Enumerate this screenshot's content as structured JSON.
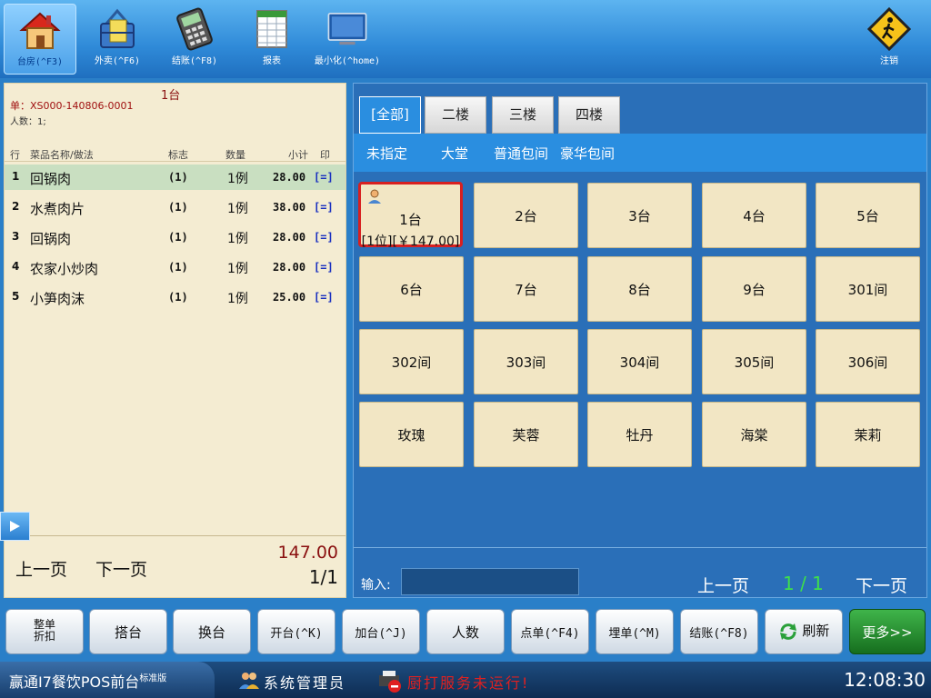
{
  "toolbar": {
    "items": [
      {
        "label": "台房(^F3)",
        "icon": "house-icon"
      },
      {
        "label": "外卖(^F6)",
        "icon": "delivery-basket-icon"
      },
      {
        "label": "结账(^F8)",
        "icon": "pos-terminal-icon"
      },
      {
        "label": "报表",
        "icon": "spreadsheet-icon"
      },
      {
        "label": "最小化(^home)",
        "icon": "monitor-icon"
      }
    ],
    "logout_label": "注销",
    "logout_icon": "pedestrian-sign-icon"
  },
  "order": {
    "table": "1台",
    "number": "单：XS000-140806-0001",
    "people": "人数：1;",
    "headers": {
      "row": "行",
      "name": "菜品名称/做法",
      "flag": "标志",
      "qty": "数量",
      "subtotal": "小计",
      "print": "印"
    },
    "items": [
      {
        "idx": "1",
        "name": "回锅肉",
        "flag": "(1)",
        "qty": "1例",
        "subtotal": "28.00",
        "print": "[=]"
      },
      {
        "idx": "2",
        "name": "水煮肉片",
        "flag": "(1)",
        "qty": "1例",
        "subtotal": "38.00",
        "print": "[=]"
      },
      {
        "idx": "3",
        "name": "回锅肉",
        "flag": "(1)",
        "qty": "1例",
        "subtotal": "28.00",
        "print": "[=]"
      },
      {
        "idx": "4",
        "name": "农家小炒肉",
        "flag": "(1)",
        "qty": "1例",
        "subtotal": "28.00",
        "print": "[=]"
      },
      {
        "idx": "5",
        "name": "小笋肉沫",
        "flag": "(1)",
        "qty": "1例",
        "subtotal": "25.00",
        "print": "[=]"
      }
    ],
    "prev": "上一页",
    "next": "下一页",
    "total": "147.00",
    "page": "1/1"
  },
  "floors": {
    "tabs": [
      "[全部]",
      "二楼",
      "三楼",
      "四楼"
    ],
    "areas": [
      "未指定",
      "大堂",
      "普通包间",
      "豪华包间"
    ]
  },
  "tables": [
    {
      "name": "1台",
      "info": "[1位][￥147.00]"
    },
    {
      "name": "2台"
    },
    {
      "name": "3台"
    },
    {
      "name": "4台"
    },
    {
      "name": "5台"
    },
    {
      "name": "6台"
    },
    {
      "name": "7台"
    },
    {
      "name": "8台"
    },
    {
      "name": "9台"
    },
    {
      "name": "301间"
    },
    {
      "name": "302间"
    },
    {
      "name": "303间"
    },
    {
      "name": "304间"
    },
    {
      "name": "305间"
    },
    {
      "name": "306间"
    },
    {
      "name": "玫瑰"
    },
    {
      "name": "芙蓉"
    },
    {
      "name": "牡丹"
    },
    {
      "name": "海棠"
    },
    {
      "name": "茉莉"
    }
  ],
  "input": {
    "label": "输入:",
    "value": ""
  },
  "table_pager": {
    "prev": "上一页",
    "page": "1 / 1",
    "next": "下一页"
  },
  "actions": {
    "merge_discount_line1": "整单",
    "merge_discount_line2": "折扣",
    "share": "搭台",
    "switch": "换台",
    "open": "开台(^K)",
    "add": "加台(^J)",
    "people": "人数",
    "order": "点单(^F4)",
    "bill": "埋单(^M)",
    "checkout": "结账(^F8)",
    "refresh": "刷新",
    "more": "更多>>"
  },
  "status": {
    "brand": "赢通I7餐饮POS前台",
    "edition": "标准版",
    "user": "系统管理员",
    "warning": "厨打服务未运行!",
    "time": "12:08:30"
  },
  "colors": {
    "accent": "#2a8ee0",
    "busy_border": "#d82020",
    "table_bg": "#f2e6c4",
    "total": "#8a1010"
  }
}
